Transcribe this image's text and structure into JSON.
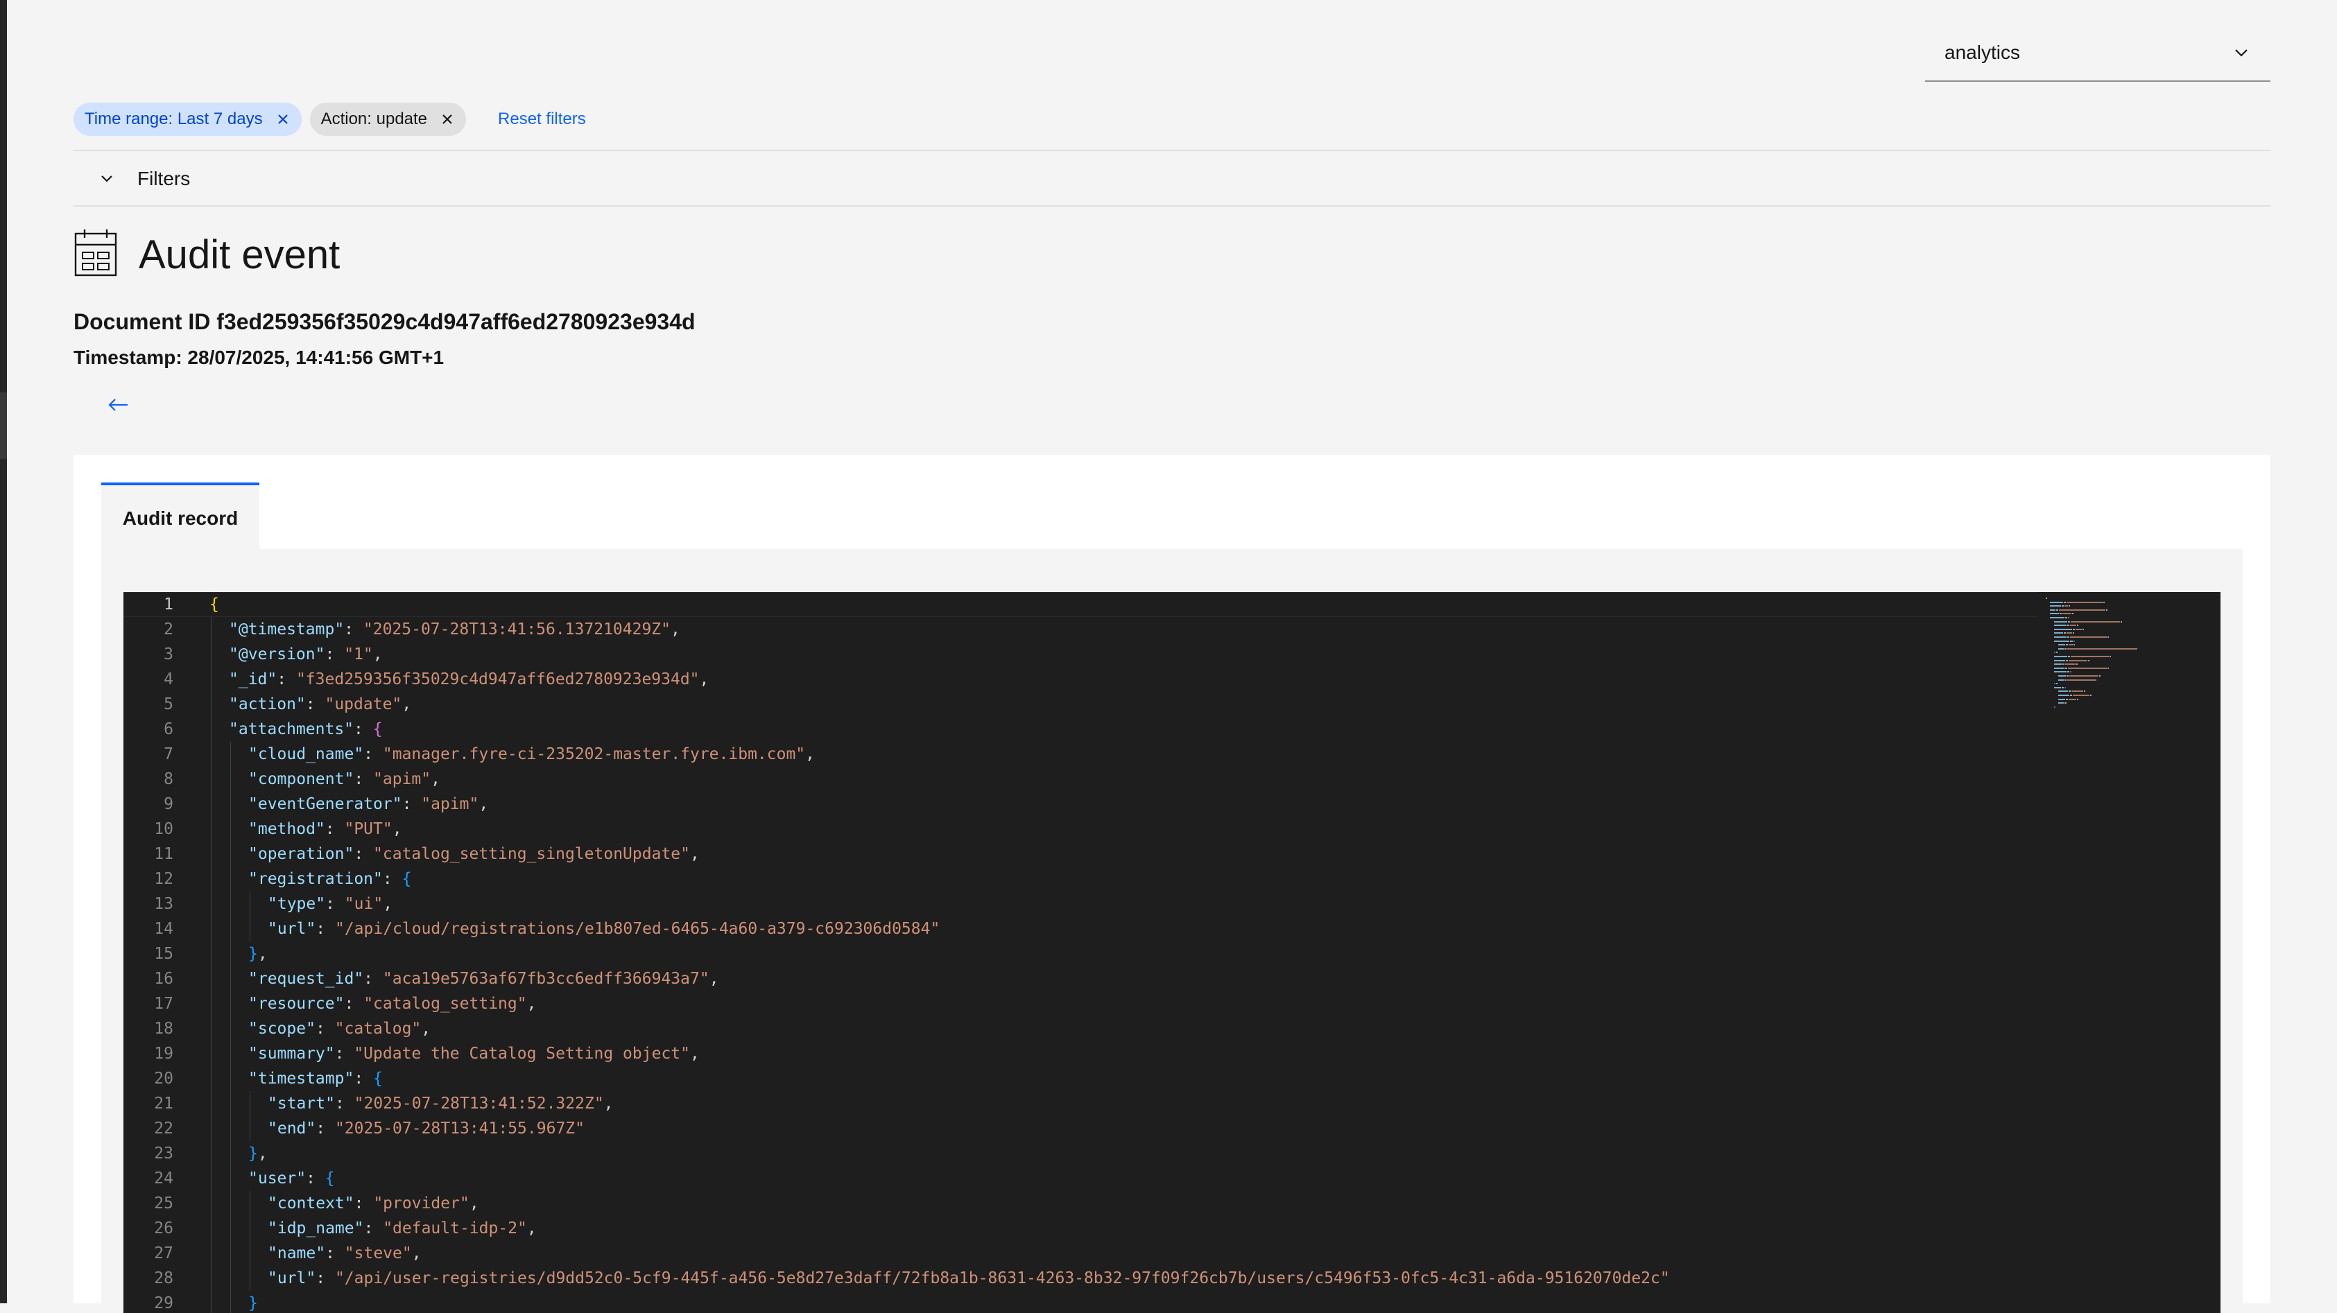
{
  "selector": {
    "value": "analytics"
  },
  "filters": {
    "tags": [
      {
        "label": "Time range: Last 7 days"
      },
      {
        "label": "Action: update"
      }
    ],
    "reset_label": "Reset filters",
    "section_label": "Filters"
  },
  "page": {
    "title": "Audit event",
    "document_id": "Document ID f3ed259356f35029c4d947aff6ed2780923e934d",
    "timestamp": "Timestamp: 28/07/2025, 14:41:56 GMT+1"
  },
  "tabs": [
    {
      "label": "Audit record",
      "selected": true
    }
  ],
  "editor": {
    "current_line": 1,
    "lines": [
      {
        "n": "1",
        "i": 0,
        "tokens": [
          [
            "{",
            "b1"
          ]
        ]
      },
      {
        "n": "2",
        "i": 1,
        "tokens": [
          [
            "\"@timestamp\"",
            "k"
          ],
          [
            ": ",
            "p"
          ],
          [
            "\"2025-07-28T13:41:56.137210429Z\"",
            "s"
          ],
          [
            ",",
            "p"
          ]
        ]
      },
      {
        "n": "3",
        "i": 1,
        "tokens": [
          [
            "\"@version\"",
            "k"
          ],
          [
            ": ",
            "p"
          ],
          [
            "\"1\"",
            "s"
          ],
          [
            ",",
            "p"
          ]
        ]
      },
      {
        "n": "4",
        "i": 1,
        "tokens": [
          [
            "\"_id\"",
            "k"
          ],
          [
            ": ",
            "p"
          ],
          [
            "\"f3ed259356f35029c4d947aff6ed2780923e934d\"",
            "s"
          ],
          [
            ",",
            "p"
          ]
        ]
      },
      {
        "n": "5",
        "i": 1,
        "tokens": [
          [
            "\"action\"",
            "k"
          ],
          [
            ": ",
            "p"
          ],
          [
            "\"update\"",
            "s"
          ],
          [
            ",",
            "p"
          ]
        ]
      },
      {
        "n": "6",
        "i": 1,
        "tokens": [
          [
            "\"attachments\"",
            "k"
          ],
          [
            ": ",
            "p"
          ],
          [
            "{",
            "b2"
          ]
        ]
      },
      {
        "n": "7",
        "i": 2,
        "tokens": [
          [
            "\"cloud_name\"",
            "k"
          ],
          [
            ": ",
            "p"
          ],
          [
            "\"manager.fyre-ci-235202-master.fyre.ibm.com\"",
            "s"
          ],
          [
            ",",
            "p"
          ]
        ]
      },
      {
        "n": "8",
        "i": 2,
        "tokens": [
          [
            "\"component\"",
            "k"
          ],
          [
            ": ",
            "p"
          ],
          [
            "\"apim\"",
            "s"
          ],
          [
            ",",
            "p"
          ]
        ]
      },
      {
        "n": "9",
        "i": 2,
        "tokens": [
          [
            "\"eventGenerator\"",
            "k"
          ],
          [
            ": ",
            "p"
          ],
          [
            "\"apim\"",
            "s"
          ],
          [
            ",",
            "p"
          ]
        ]
      },
      {
        "n": "10",
        "i": 2,
        "tokens": [
          [
            "\"method\"",
            "k"
          ],
          [
            ": ",
            "p"
          ],
          [
            "\"PUT\"",
            "s"
          ],
          [
            ",",
            "p"
          ]
        ]
      },
      {
        "n": "11",
        "i": 2,
        "tokens": [
          [
            "\"operation\"",
            "k"
          ],
          [
            ": ",
            "p"
          ],
          [
            "\"catalog_setting_singletonUpdate\"",
            "s"
          ],
          [
            ",",
            "p"
          ]
        ]
      },
      {
        "n": "12",
        "i": 2,
        "tokens": [
          [
            "\"registration\"",
            "k"
          ],
          [
            ": ",
            "p"
          ],
          [
            "{",
            "b3"
          ]
        ]
      },
      {
        "n": "13",
        "i": 3,
        "tokens": [
          [
            "\"type\"",
            "k"
          ],
          [
            ": ",
            "p"
          ],
          [
            "\"ui\"",
            "s"
          ],
          [
            ",",
            "p"
          ]
        ]
      },
      {
        "n": "14",
        "i": 3,
        "tokens": [
          [
            "\"url\"",
            "k"
          ],
          [
            ": ",
            "p"
          ],
          [
            "\"/api/cloud/registrations/e1b807ed-6465-4a60-a379-c692306d0584\"",
            "s"
          ]
        ]
      },
      {
        "n": "15",
        "i": 2,
        "tokens": [
          [
            "}",
            "b3"
          ],
          [
            ",",
            "p"
          ]
        ]
      },
      {
        "n": "16",
        "i": 2,
        "tokens": [
          [
            "\"request_id\"",
            "k"
          ],
          [
            ": ",
            "p"
          ],
          [
            "\"aca19e5763af67fb3cc6edff366943a7\"",
            "s"
          ],
          [
            ",",
            "p"
          ]
        ]
      },
      {
        "n": "17",
        "i": 2,
        "tokens": [
          [
            "\"resource\"",
            "k"
          ],
          [
            ": ",
            "p"
          ],
          [
            "\"catalog_setting\"",
            "s"
          ],
          [
            ",",
            "p"
          ]
        ]
      },
      {
        "n": "18",
        "i": 2,
        "tokens": [
          [
            "\"scope\"",
            "k"
          ],
          [
            ": ",
            "p"
          ],
          [
            "\"catalog\"",
            "s"
          ],
          [
            ",",
            "p"
          ]
        ]
      },
      {
        "n": "19",
        "i": 2,
        "tokens": [
          [
            "\"summary\"",
            "k"
          ],
          [
            ": ",
            "p"
          ],
          [
            "\"Update the Catalog Setting object\"",
            "s"
          ],
          [
            ",",
            "p"
          ]
        ]
      },
      {
        "n": "20",
        "i": 2,
        "tokens": [
          [
            "\"timestamp\"",
            "k"
          ],
          [
            ": ",
            "p"
          ],
          [
            "{",
            "b3"
          ]
        ]
      },
      {
        "n": "21",
        "i": 3,
        "tokens": [
          [
            "\"start\"",
            "k"
          ],
          [
            ": ",
            "p"
          ],
          [
            "\"2025-07-28T13:41:52.322Z\"",
            "s"
          ],
          [
            ",",
            "p"
          ]
        ]
      },
      {
        "n": "22",
        "i": 3,
        "tokens": [
          [
            "\"end\"",
            "k"
          ],
          [
            ": ",
            "p"
          ],
          [
            "\"2025-07-28T13:41:55.967Z\"",
            "s"
          ]
        ]
      },
      {
        "n": "23",
        "i": 2,
        "tokens": [
          [
            "}",
            "b3"
          ],
          [
            ",",
            "p"
          ]
        ]
      },
      {
        "n": "24",
        "i": 2,
        "tokens": [
          [
            "\"user\"",
            "k"
          ],
          [
            ": ",
            "p"
          ],
          [
            "{",
            "b3"
          ]
        ]
      },
      {
        "n": "25",
        "i": 3,
        "tokens": [
          [
            "\"context\"",
            "k"
          ],
          [
            ": ",
            "p"
          ],
          [
            "\"provider\"",
            "s"
          ],
          [
            ",",
            "p"
          ]
        ]
      },
      {
        "n": "26",
        "i": 3,
        "tokens": [
          [
            "\"idp_name\"",
            "k"
          ],
          [
            ": ",
            "p"
          ],
          [
            "\"default-idp-2\"",
            "s"
          ],
          [
            ",",
            "p"
          ]
        ]
      },
      {
        "n": "27",
        "i": 3,
        "tokens": [
          [
            "\"name\"",
            "k"
          ],
          [
            ": ",
            "p"
          ],
          [
            "\"steve\"",
            "s"
          ],
          [
            ",",
            "p"
          ]
        ]
      },
      {
        "n": "28",
        "i": 3,
        "tokens": [
          [
            "\"url\"",
            "k"
          ],
          [
            ": ",
            "p"
          ],
          [
            "\"/api/user-registries/d9dd52c0-5cf9-445f-a456-5e8d27e3daff/72fb8a1b-8631-4263-8b32-97f09f26cb7b/users/c5496f53-0fc5-4c31-a6da-95162070de2c\"",
            "s"
          ]
        ]
      },
      {
        "n": "29",
        "i": 2,
        "tokens": [
          [
            "}",
            "b3"
          ]
        ]
      }
    ]
  },
  "colors": {
    "accent": "#0f62fe",
    "editor_bg": "#1e1e1e",
    "json_key": "#9cdcfe",
    "json_string": "#ce9178",
    "bracket_level1": "#ffd700",
    "bracket_level2": "#da70d6",
    "bracket_level3": "#179fff"
  },
  "icons": {
    "selector": "chevron-down-icon",
    "tag_close": "close-icon",
    "filters_toggle": "chevron-down-icon",
    "title": "audit-event-icon",
    "back": "arrow-left-icon"
  }
}
